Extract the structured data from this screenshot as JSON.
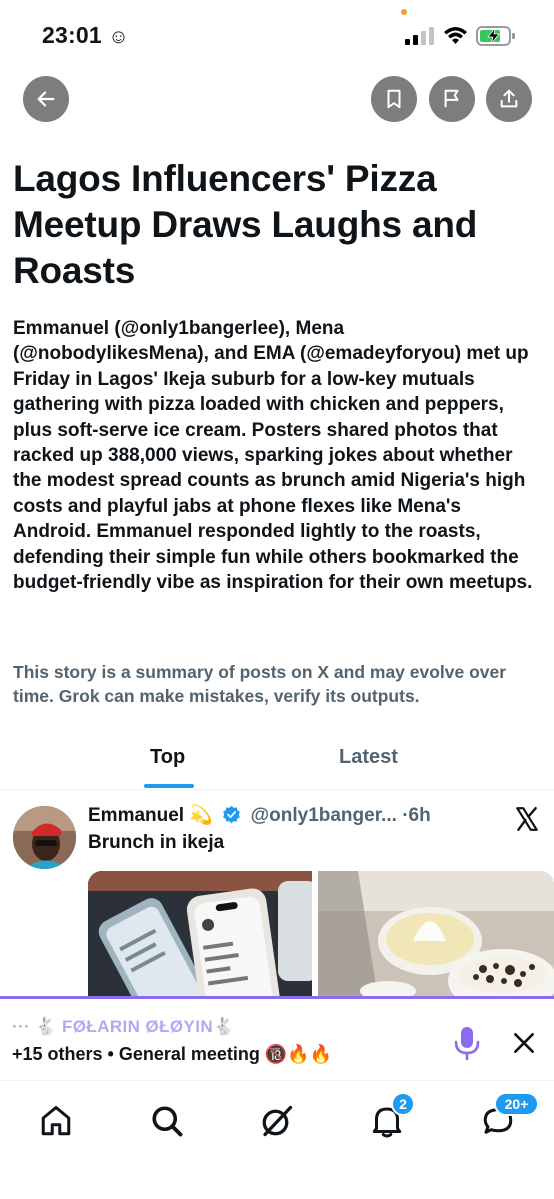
{
  "status": {
    "time": "23:01",
    "time_icon": "smiley-icon"
  },
  "toolbar": {
    "back": "back-arrow-icon",
    "bookmark": "bookmark-icon",
    "flag": "flag-icon",
    "share": "share-icon",
    "button_color": "#7d7d7d"
  },
  "story": {
    "title": "Lagos Influencers' Pizza Meetup Draws Laughs and Roasts",
    "summary": "Emmanuel (@only1bangerlee), Mena (@nobodylikesMena), and EMA (@emadeyforyou) met up Friday in Lagos' Ikeja suburb for a low-key mutuals gathering with pizza loaded with chicken and peppers, plus soft-serve ice cream. Posters shared photos that racked up 388,000 views, sparking jokes about whether the modest spread counts as brunch amid Nigeria's high costs and playful jabs at phone flexes like Mena's Android. Emmanuel responded lightly to the roasts, defending their simple fun while others bookmarked the budget-friendly vibe as inspiration for their own meetups.",
    "disclaimer": "This story is a summary of posts on X and may evolve over time. Grok can make mistakes, verify its outputs."
  },
  "tabs": [
    {
      "label": "Top",
      "active": true
    },
    {
      "label": "Latest",
      "active": false
    }
  ],
  "post": {
    "name": "Emmanuel",
    "name_emoji": "💫",
    "handle": "@only1banger...",
    "separator": "·",
    "time": "6h",
    "text": "Brunch in ikeja"
  },
  "space": {
    "title": "··· 🐇 FØŁARIN ØŁØYIN🐇",
    "subtitle": "+15 others • General  meeting 🔞🔥🔥",
    "accent": "#8b6cf0"
  },
  "nav": {
    "items": [
      "home-icon",
      "search-icon",
      "grok-icon",
      "notifications-icon",
      "messages-icon"
    ],
    "notifications_badge": "2",
    "messages_badge": "20+",
    "accent": "#1d9bf0"
  }
}
